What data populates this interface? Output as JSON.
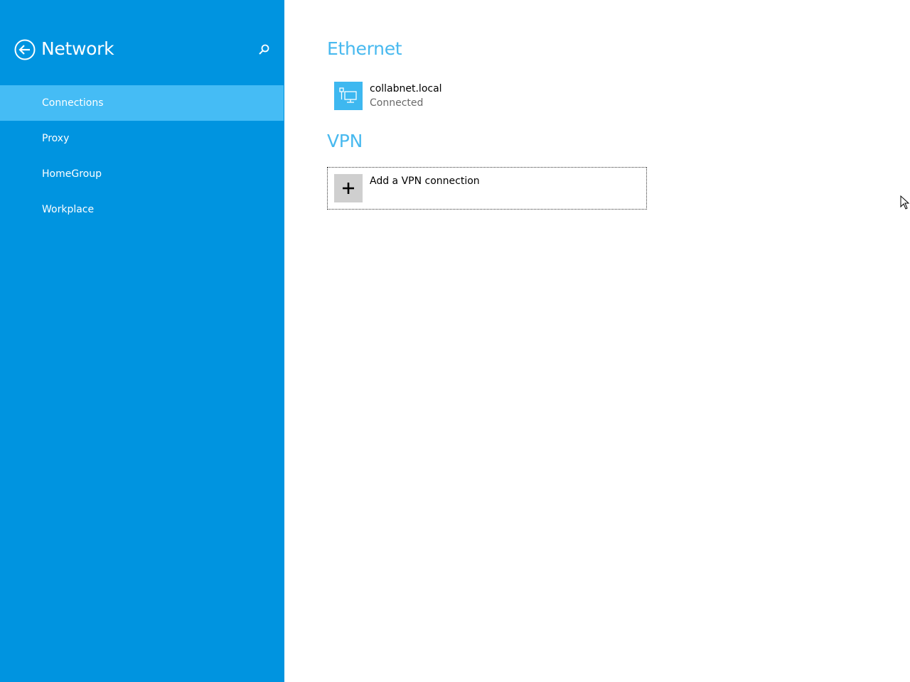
{
  "sidebar": {
    "title": "Network",
    "back_icon": "back-arrow-icon",
    "search_icon": "search-icon",
    "background_color": "#0094e0",
    "selected_color": "#45bcf5",
    "items": [
      {
        "label": "Connections",
        "selected": true
      },
      {
        "label": "Proxy",
        "selected": false
      },
      {
        "label": "HomeGroup",
        "selected": false
      },
      {
        "label": "Workplace",
        "selected": false
      }
    ]
  },
  "main": {
    "heading_color": "#48b9ef",
    "ethernet": {
      "heading": "Ethernet",
      "connection": {
        "icon": "ethernet-monitor-icon",
        "name": "collabnet.local",
        "status": "Connected"
      }
    },
    "vpn": {
      "heading": "VPN",
      "add_button": {
        "icon": "plus-icon",
        "label": "Add a VPN connection"
      }
    }
  }
}
